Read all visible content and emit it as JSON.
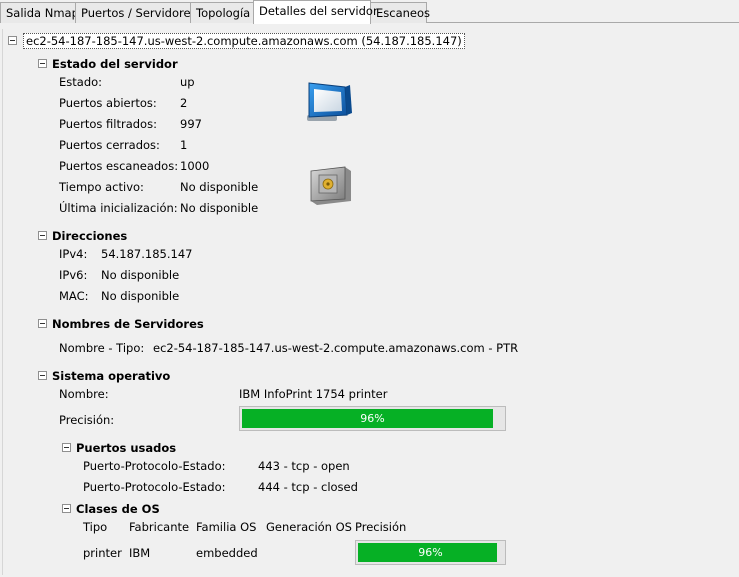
{
  "tabs": [
    {
      "label": "Salida Nmap"
    },
    {
      "label": "Puertos / Servidores"
    },
    {
      "label": "Topología"
    },
    {
      "label": "Detalles del servidor"
    },
    {
      "label": "Escaneos"
    }
  ],
  "host": {
    "title": "ec2-54-187-185-147.us-west-2.compute.amazonaws.com (54.187.185.147)"
  },
  "status": {
    "heading": "Estado del servidor",
    "rows": [
      {
        "label": "Estado:",
        "value": "up"
      },
      {
        "label": "Puertos abiertos:",
        "value": "2"
      },
      {
        "label": "Puertos filtrados:",
        "value": "997"
      },
      {
        "label": "Puertos cerrados:",
        "value": "1"
      },
      {
        "label": "Puertos escaneados:",
        "value": "1000"
      },
      {
        "label": "Tiempo activo:",
        "value": "No disponible"
      },
      {
        "label": "Última inicialización:",
        "value": "No disponible"
      }
    ]
  },
  "addresses": {
    "heading": "Direcciones",
    "rows": [
      {
        "label": "IPv4:",
        "value": "54.187.185.147"
      },
      {
        "label": "IPv6:",
        "value": "No disponible"
      },
      {
        "label": "MAC:",
        "value": "No disponible"
      }
    ]
  },
  "hostnames": {
    "heading": "Nombres de Servidores",
    "label": "Nombre - Tipo:",
    "value": "ec2-54-187-185-147.us-west-2.compute.amazonaws.com - PTR"
  },
  "os": {
    "heading": "Sistema operativo",
    "name_label": "Nombre:",
    "name_value": "IBM InfoPrint 1754 printer",
    "accuracy_label": "Precisión:",
    "accuracy_text": "96%",
    "accuracy_value": 0.96,
    "ports_used": {
      "heading": "Puertos usados",
      "rows": [
        {
          "label": "Puerto-Protocolo-Estado:",
          "value": "443 - tcp - open"
        },
        {
          "label": "Puerto-Protocolo-Estado:",
          "value": "444 - tcp - closed"
        }
      ]
    },
    "classes": {
      "heading": "Clases de OS",
      "columns": [
        "Tipo",
        "Fabricante",
        "Familia OS",
        "Generación OS",
        "Precisión"
      ],
      "row": {
        "type": "printer",
        "vendor": "IBM",
        "family": "embedded",
        "generation": "",
        "accuracy_text": "96%",
        "accuracy_value": 0.96
      }
    }
  },
  "icons": {
    "monitor": "monitor-icon",
    "safe": "safe-icon"
  }
}
